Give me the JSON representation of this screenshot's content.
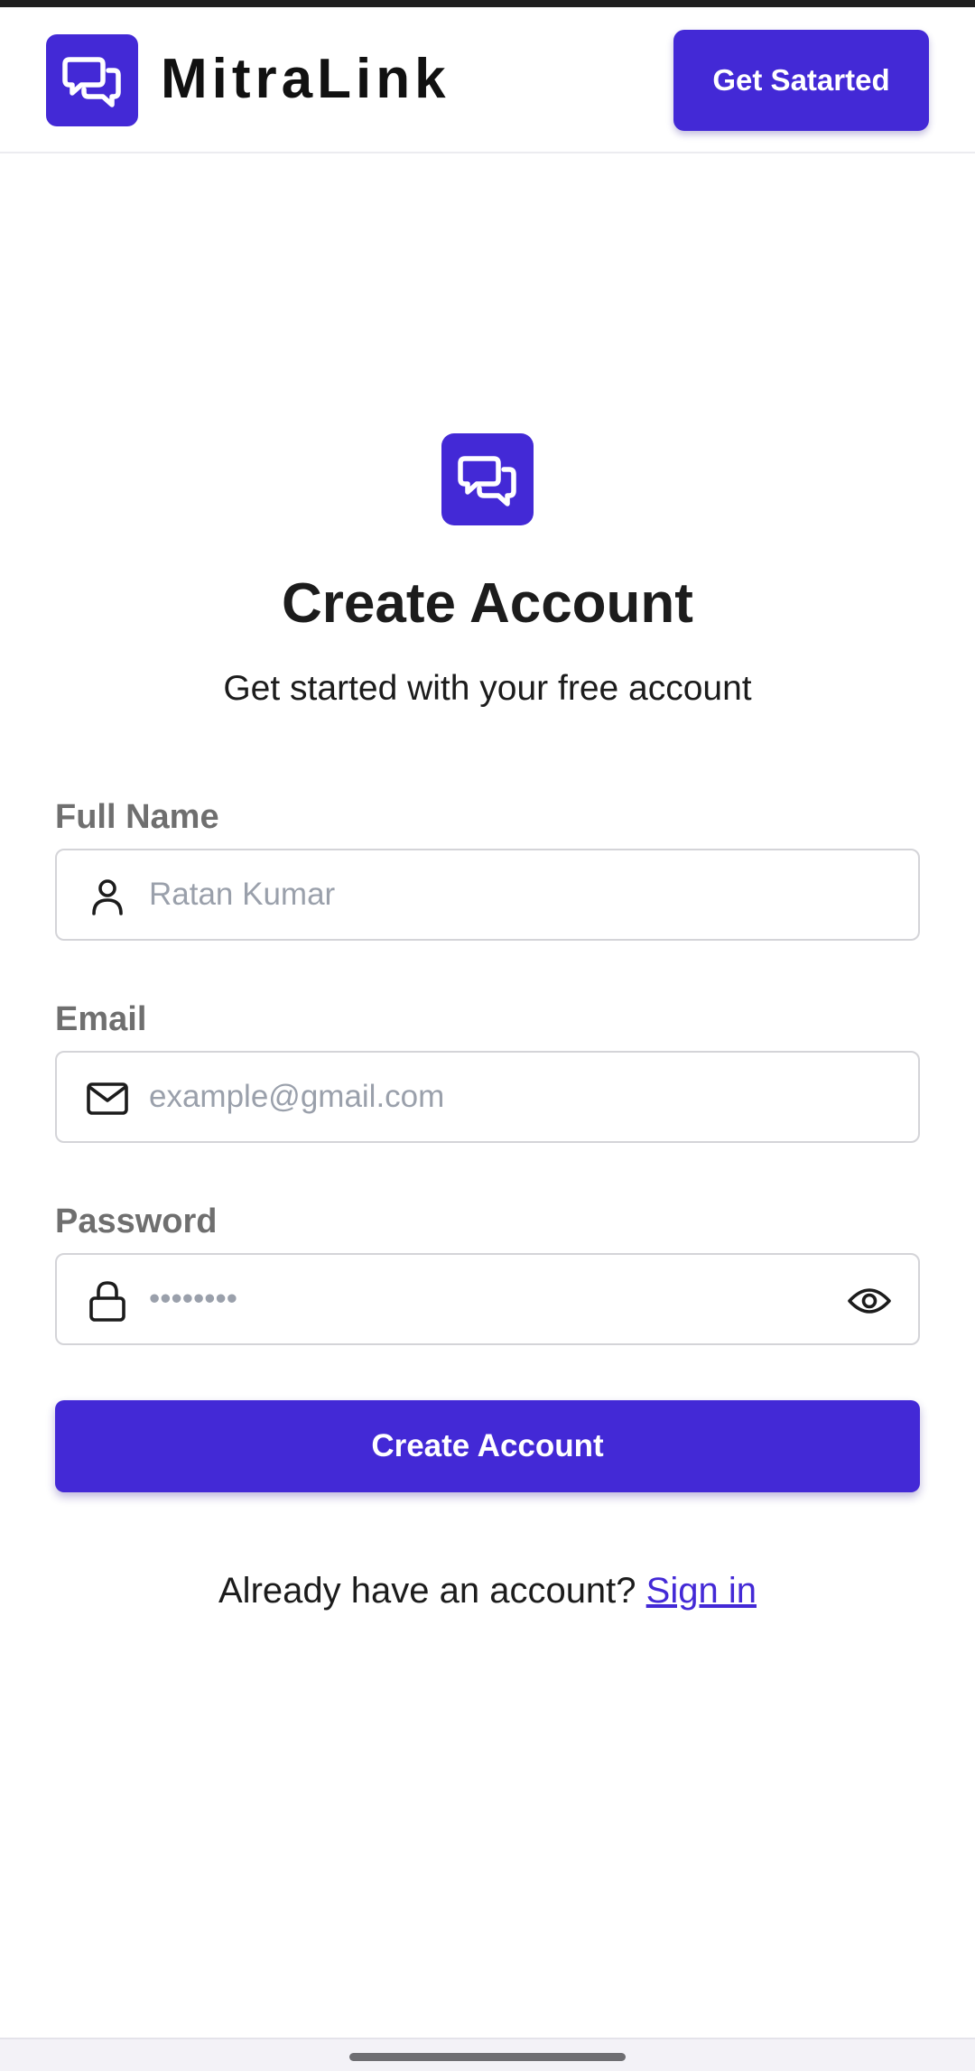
{
  "header": {
    "brand_name": "MitraLink",
    "cta_label": "Get Satarted",
    "logo_icon": "chat-bubbles-icon"
  },
  "hero": {
    "logo_icon": "chat-bubbles-icon",
    "title": "Create Account",
    "subtitle": "Get started with your free account"
  },
  "form": {
    "full_name": {
      "label": "Full Name",
      "placeholder": "Ratan Kumar",
      "value": "",
      "icon": "user-icon"
    },
    "email": {
      "label": "Email",
      "placeholder": "example@gmail.com",
      "value": "",
      "icon": "mail-icon"
    },
    "password": {
      "label": "Password",
      "placeholder": "••••••••",
      "value": "",
      "icon": "lock-icon",
      "toggle_icon": "eye-icon"
    },
    "submit_label": "Create Account"
  },
  "footer": {
    "prompt_text": "Already have an account?",
    "signin_label": "Sign in"
  },
  "colors": {
    "accent": "#4329d6",
    "label_gray": "#6f6f6f",
    "placeholder_gray": "#9aa0ab",
    "border": "#d4d4d8"
  }
}
